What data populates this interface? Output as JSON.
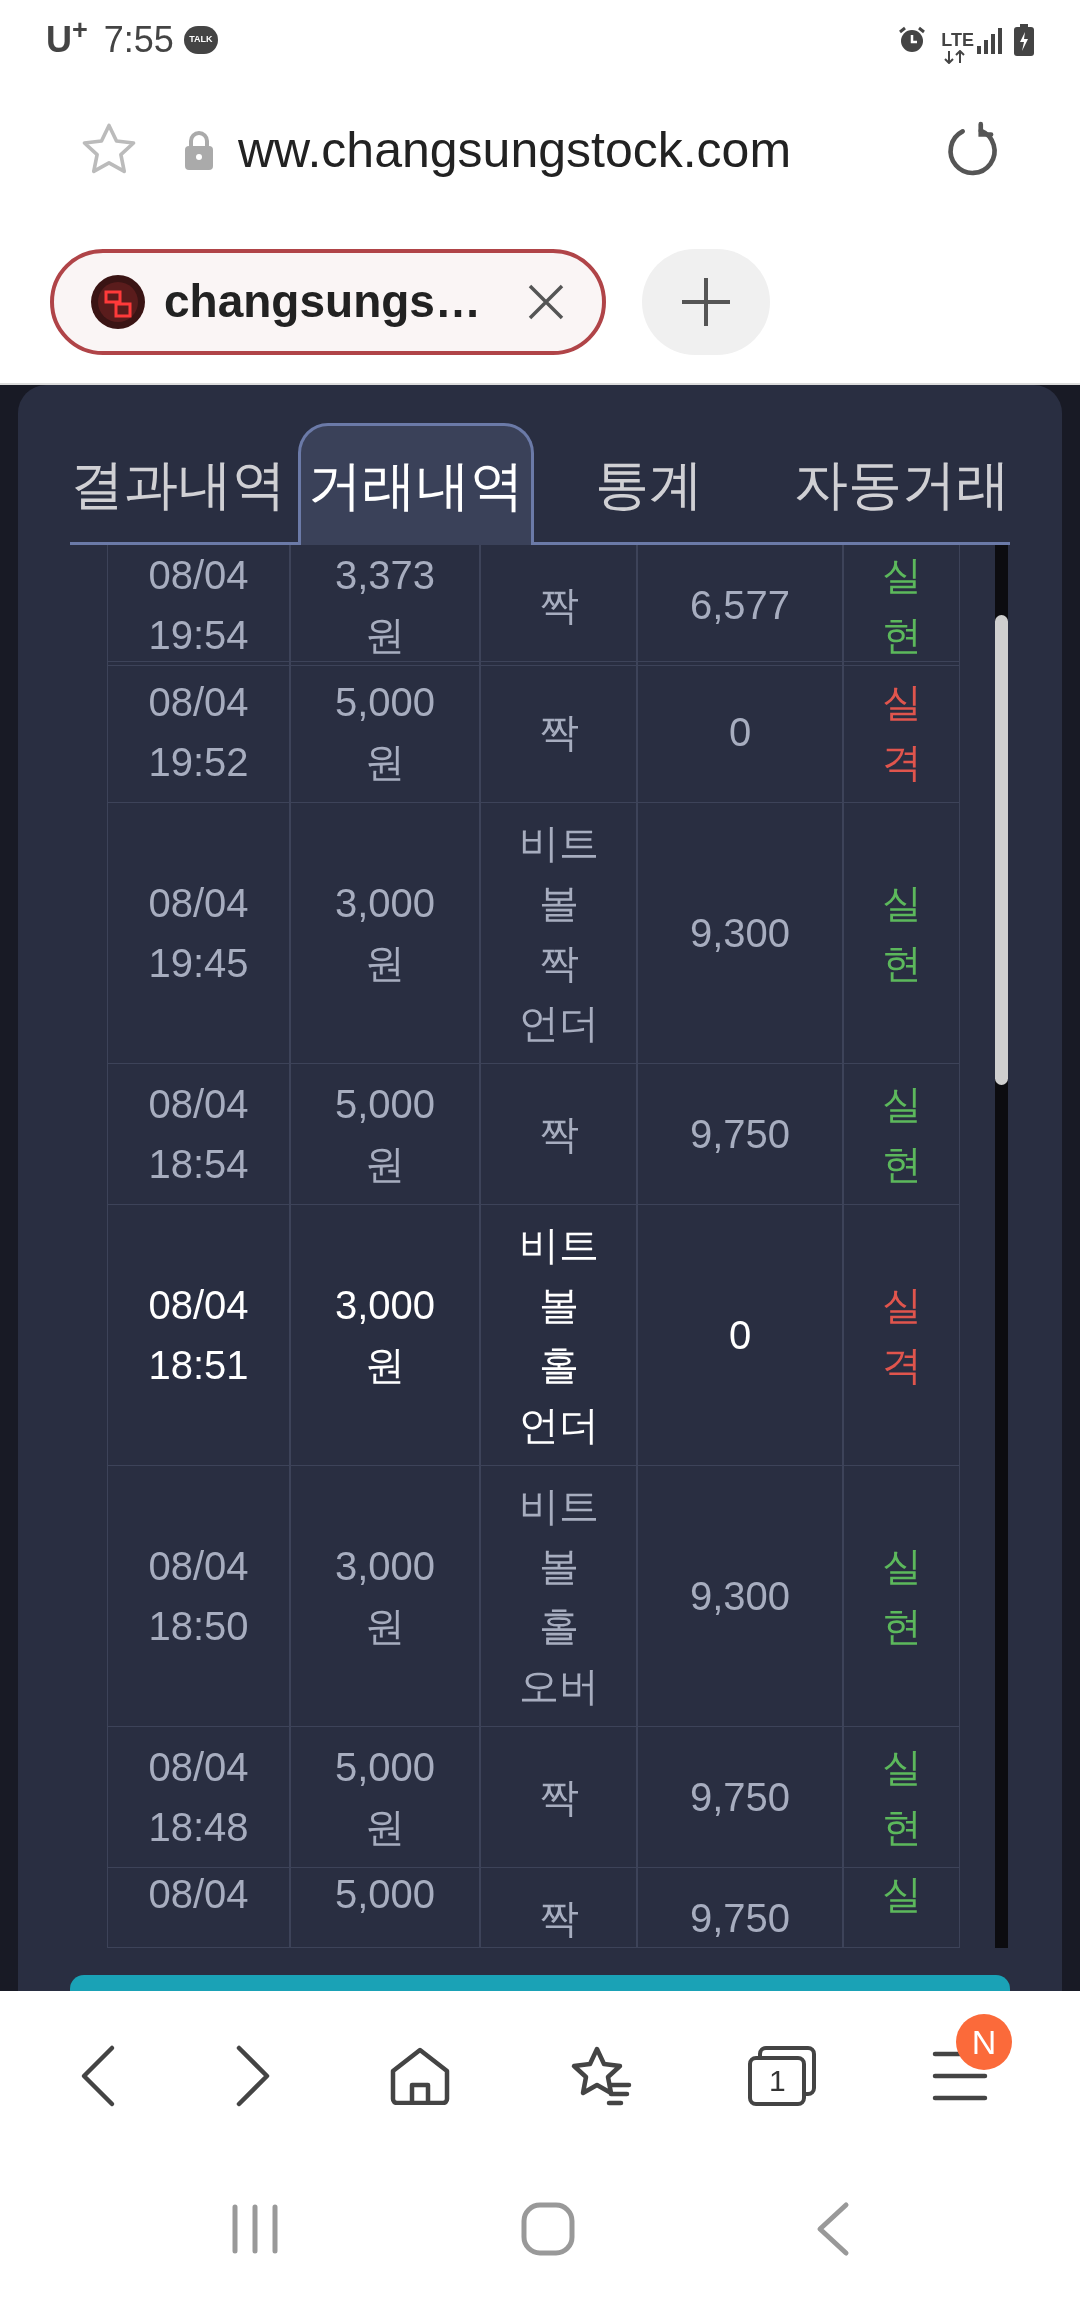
{
  "status_bar": {
    "carrier": "U$^{+}$",
    "time": "7:55",
    "chat_badge": "TALK",
    "network": "LTE"
  },
  "browser": {
    "url": "ww.changsungstock.com",
    "tab_title": "changsungs…",
    "tab_count": "1",
    "menu_badge": "N"
  },
  "tabs": [
    {
      "label": "결과내역",
      "selected": false
    },
    {
      "label": "거래내역",
      "selected": true
    },
    {
      "label": "통계",
      "selected": false
    },
    {
      "label": "자동거래",
      "selected": false
    }
  ],
  "rows": [
    {
      "kind": "top",
      "datetime": "08/04 19:54",
      "amount": "3,373 원",
      "pick": "짝",
      "payout": "6,577",
      "result": "실현",
      "color": "#5cb85c",
      "selected": false
    },
    {
      "kind": "full",
      "datetime": "08/04 19:52",
      "amount": "5,000 원",
      "pick": "짝",
      "payout": "0",
      "result": "실격",
      "color": "#e0554d",
      "selected": false
    },
    {
      "kind": "full",
      "datetime": "08/04 19:45",
      "amount": "3,000 원",
      "pick": "비트 볼 짝 언더",
      "payout": "9,300",
      "result": "실현",
      "color": "#5cb85c",
      "selected": false
    },
    {
      "kind": "full",
      "datetime": "08/04 18:54",
      "amount": "5,000 원",
      "pick": "짝",
      "payout": "9,750",
      "result": "실현",
      "color": "#5cb85c",
      "selected": false
    },
    {
      "kind": "full",
      "datetime": "08/04 18:51",
      "amount": "3,000 원",
      "pick": "비트 볼 홀 언더",
      "payout": "0",
      "result": "실격",
      "color": "#e0554d",
      "selected": true
    },
    {
      "kind": "full",
      "datetime": "08/04 18:50",
      "amount": "3,000 원",
      "pick": "비트 볼 홀 오버",
      "payout": "9,300",
      "result": "실현",
      "color": "#5cb85c",
      "selected": false
    },
    {
      "kind": "full",
      "datetime": "08/04 18:48",
      "amount": "5,000 원",
      "pick": "짝",
      "payout": "9,750",
      "result": "실현",
      "color": "#5cb85c",
      "selected": false
    },
    {
      "kind": "cut",
      "datetime": "08/04",
      "amount": "5,000",
      "pick": "짝",
      "payout": "9,750",
      "result": "실",
      "color": "#5cb85c",
      "selected": false
    }
  ]
}
